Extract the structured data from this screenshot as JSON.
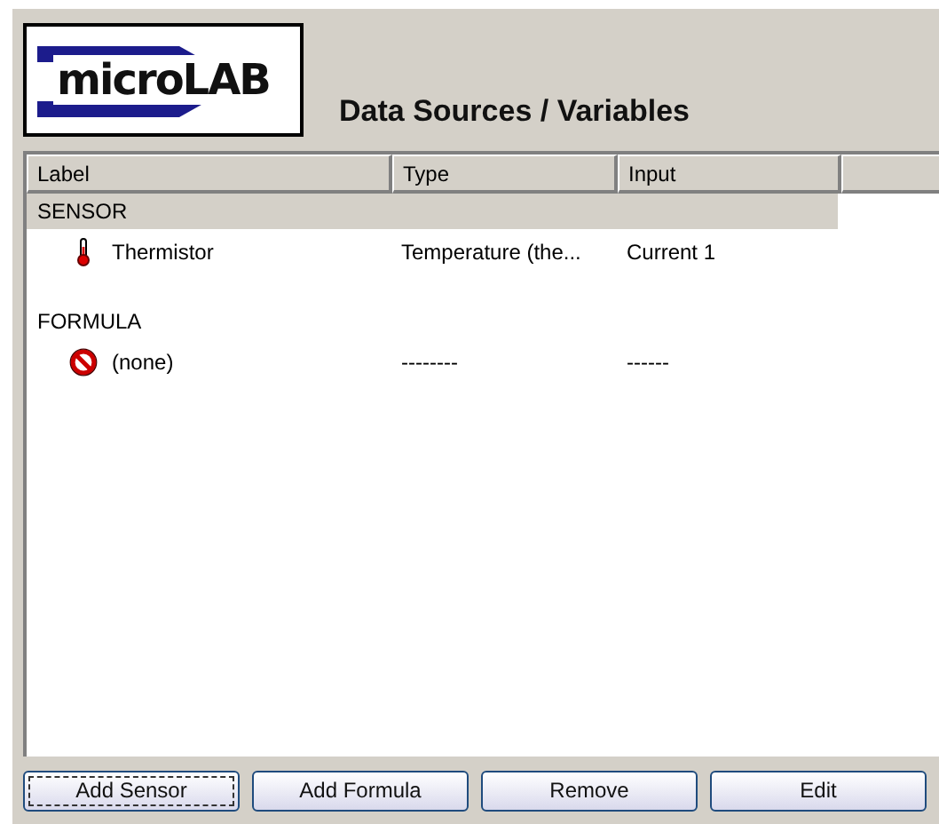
{
  "logo": {
    "text": "microLAB"
  },
  "title": "Data Sources / Variables",
  "table": {
    "columns": [
      "Label",
      "Type",
      "Input"
    ],
    "groups": [
      {
        "name": "SENSOR",
        "selected": true,
        "rows": [
          {
            "kind": "sensor",
            "label": "Thermistor",
            "type": "Temperature (the...",
            "input": "Current 1"
          }
        ]
      },
      {
        "name": "FORMULA",
        "selected": false,
        "rows": [
          {
            "kind": "empty",
            "label": "(none)",
            "type": "--------",
            "input": "------"
          }
        ]
      }
    ]
  },
  "buttons": [
    {
      "label": "Add Sensor",
      "focused": true
    },
    {
      "label": "Add Formula",
      "focused": false
    },
    {
      "label": "Remove",
      "focused": false
    },
    {
      "label": "Edit",
      "focused": false
    }
  ]
}
